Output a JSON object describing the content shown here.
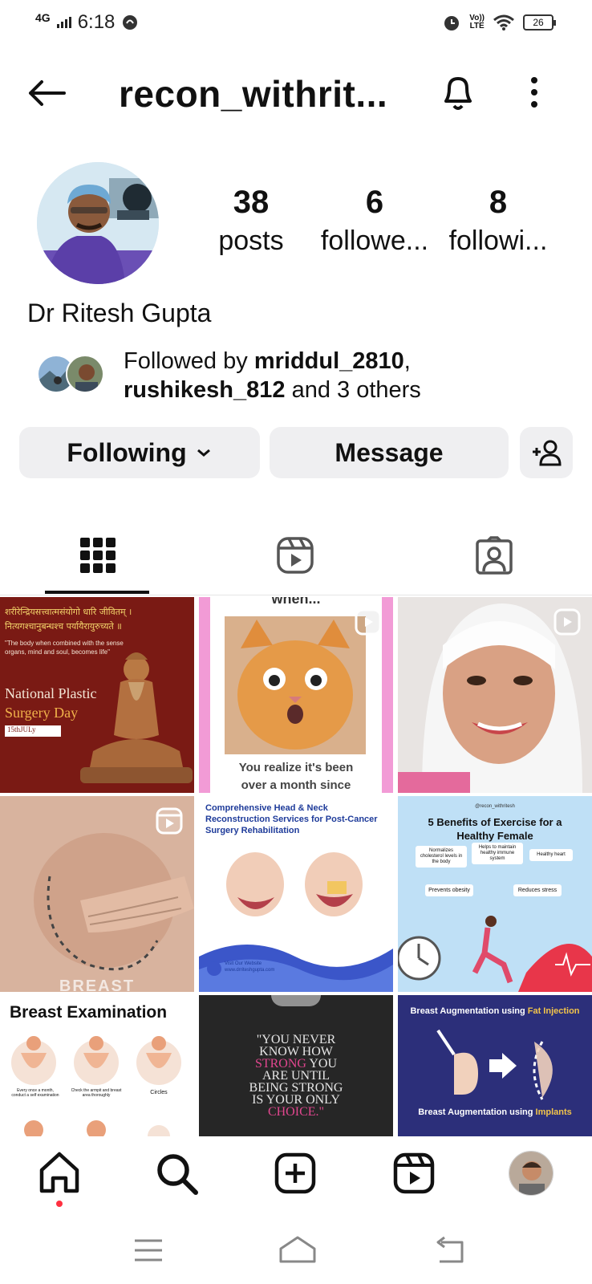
{
  "status_bar": {
    "network": "4G",
    "time": "6:18",
    "volte_line1": "Vo))",
    "volte_line2": "LTE",
    "battery": "26"
  },
  "header": {
    "title": "recon_withrit..."
  },
  "profile": {
    "name": "Dr Ritesh Gupta",
    "stats": [
      {
        "value": "38",
        "label": "posts"
      },
      {
        "value": "6",
        "label": "followe..."
      },
      {
        "value": "8",
        "label": "followi..."
      }
    ],
    "followed_prefix": "Followed by ",
    "followed_user1": "mriddul_2810",
    "followed_sep": ",",
    "followed_user2": "rushikesh_812",
    "followed_suffix": " and 3 others"
  },
  "buttons": {
    "following": "Following",
    "message": "Message"
  },
  "posts": [
    {
      "devanagari1": "शरीरेन्द्रियसत्त्वात्मसंयोगो धारि जीवितम् ।",
      "devanagari2": "नित्यगश्चानुबन्धश्च पर्यायैरायुरुच्यते ॥",
      "quote": "\"The body when combined with the sense organs, mind and soul, becomes life\"",
      "title1": "National Plastic",
      "title2": "Surgery Day",
      "date": "15thJULy"
    },
    {
      "top_text": "when...",
      "caption1": "You realize it's been",
      "caption2": "over a month since"
    },
    {},
    {
      "bottom_text": "BREAST"
    },
    {
      "title": "Comprehensive Head & Neck Reconstruction Services for Post-Cancer Surgery Rehabilitation",
      "footer": "Visit Our Website",
      "url": "www.drriteshgupta.com"
    },
    {
      "handle": "@recon_withritesh",
      "title": "5 Benefits of Exercise for a Healthy Female",
      "b1": "Normalizes cholesterol levels in the body",
      "b2": "Helps to maintain healthy immune system",
      "b3": "Healthy heart",
      "b4": "Prevents obesity",
      "b5": "Reduces stress"
    },
    {
      "title": "Breast Examination",
      "c1": "Every once a month, conduct a self examination",
      "c2": "Check the armpit and breast area thoroughly",
      "c3": "Circles"
    },
    {
      "q1": "\"YOU NEVER",
      "q2": "KNOW HOW",
      "q3a": "STRONG",
      "q3b": " YOU",
      "q4": "ARE UNTIL",
      "q5": "BEING STRONG",
      "q6": "IS YOUR ONLY",
      "q7": "CHOICE.\""
    },
    {
      "t1a": "Breast Augmentation using ",
      "t1b": "Fat Injection",
      "t2a": "Breast Augmentation using ",
      "t2b": "Implants"
    }
  ],
  "colors": {
    "accent_notification": "#ff3040",
    "button_bg": "#efeff1",
    "text": "#111111"
  }
}
